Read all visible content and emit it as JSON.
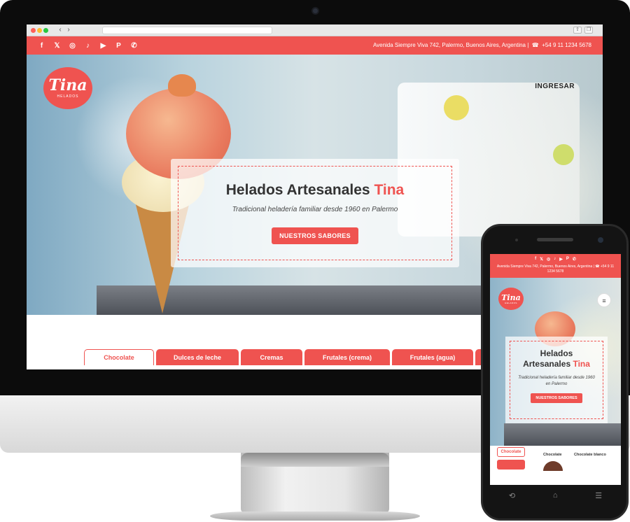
{
  "desktop": {
    "topbar": {
      "social_icons": [
        "facebook-icon",
        "x-icon",
        "instagram-icon",
        "tiktok-icon",
        "youtube-icon",
        "pinterest-icon",
        "whatsapp-icon"
      ],
      "address": "Avenida Siempre Viva 742, Palermo, Buenos Aires, Argentina |",
      "phone": "+54 9 11 1234 5678"
    },
    "logo": {
      "word": "Tina",
      "sub": "HELADOS"
    },
    "login_label": "INGRESAR",
    "hero": {
      "title_main": "Helados Artesanales",
      "title_accent": "Tina",
      "subtitle": "Tradicional heladería familiar desde 1960 en Palermo",
      "cta_label": "NUESTROS SABORES"
    },
    "tabs": [
      "Chocolate",
      "Dulces de leche",
      "Cremas",
      "Frutales (crema)",
      "Frutales (agua)"
    ]
  },
  "mobile": {
    "topbar": {
      "contact": "Avenida Siempre Viva 742, Palermo, Buenos Aires, Argentina | ☎ +54 9 11 1234 5678"
    },
    "logo": {
      "word": "Tina",
      "sub": "HELADOS"
    },
    "hero": {
      "title_main": "Helados Artesanales",
      "title_accent": "Tina",
      "subtitle": "Tradicional heladería familiar desde 1960 en Palermo",
      "cta_label": "NUESTROS SABORES"
    },
    "tabs": [
      "Chocolate"
    ],
    "flavors": [
      "Chocolate",
      "Chocolate blanco"
    ]
  },
  "colors": {
    "accent": "#ef5350",
    "text": "#333333"
  }
}
